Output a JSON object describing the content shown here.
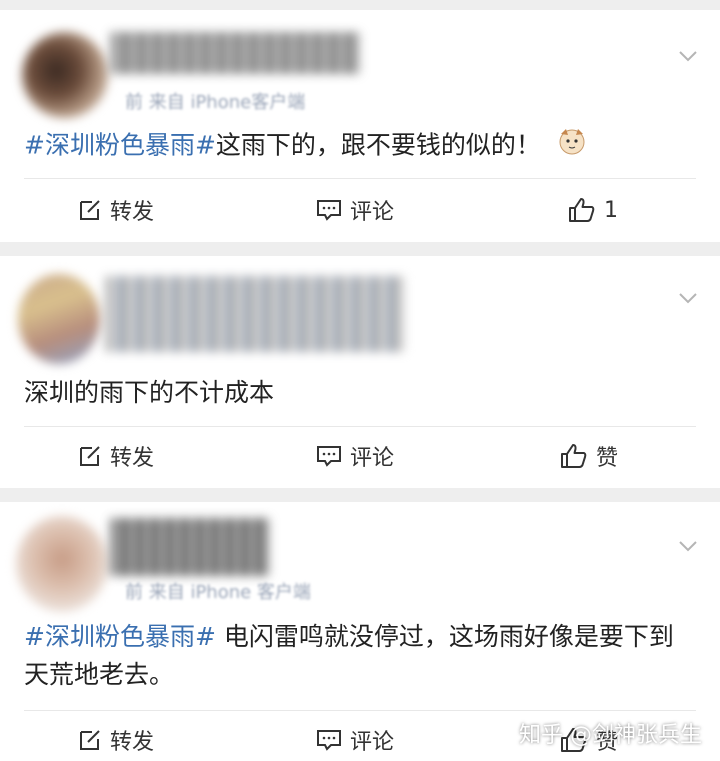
{
  "posts": [
    {
      "meta": "前 来自 iPhone客户端",
      "hashtag": "#深圳粉色暴雨#",
      "text": "这雨下的，跟不要钱的似的！",
      "emoji": "🐱",
      "actions": {
        "repost": "转发",
        "comment": "评论",
        "like": "1"
      }
    },
    {
      "meta": "",
      "hashtag": "",
      "text": "深圳的雨下的不计成本",
      "emoji": "",
      "actions": {
        "repost": "转发",
        "comment": "评论",
        "like": "赞"
      }
    },
    {
      "meta": "前 来自 iPhone 客户端",
      "hashtag": "#深圳粉色暴雨#",
      "text": " 电闪雷鸣就没停过，这场雨好像是要下到天荒地老去。",
      "emoji": "",
      "actions": {
        "repost": "转发",
        "comment": "评论",
        "like": "赞"
      }
    }
  ],
  "watermark": "知乎 @剑神张兵生",
  "colors": {
    "hashtag": "#3a6fb0",
    "background": "#eeeeee",
    "card": "#ffffff"
  },
  "icons": [
    "chevron-down-icon",
    "repost-icon",
    "comment-icon",
    "like-icon",
    "cat-emoji-icon"
  ]
}
